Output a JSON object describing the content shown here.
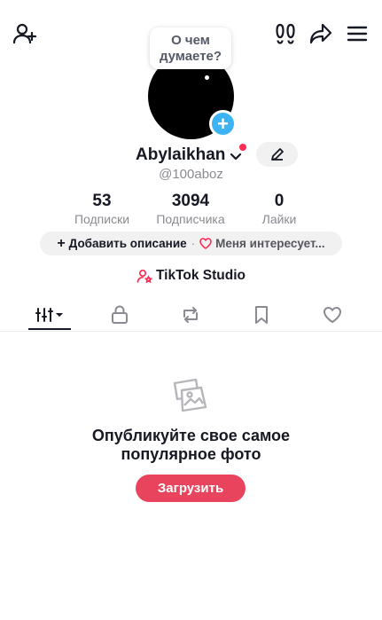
{
  "header": {
    "icons": [
      "add-user-icon",
      "footprints-icon",
      "share-icon",
      "menu-icon"
    ]
  },
  "profile": {
    "bubble_text": "О чем думаете?",
    "username": "Abylaikhan",
    "handle": "@100aboz",
    "avatar_add_label": "+"
  },
  "stats": [
    {
      "value": "53",
      "label": "Подписки"
    },
    {
      "value": "3094",
      "label": "Подписчика"
    },
    {
      "value": "0",
      "label": "Лайки"
    }
  ],
  "bio_pill": {
    "add_description": "Добавить описание",
    "separator": "·",
    "interests": "Меня интересует..."
  },
  "studio": {
    "label": "TikTok Studio"
  },
  "tabs": [
    "posts-grid-icon",
    "lock-icon",
    "repost-icon",
    "bookmark-icon",
    "heart-icon"
  ],
  "empty_state": {
    "title_line1": "Опубликуйте свое самое",
    "title_line2": "популярное фото",
    "button_label": "Загрузить"
  },
  "colors": {
    "accent": "#fe2c55",
    "upload_button": "#e8445d",
    "avatar_plus": "#3cb3f2",
    "muted_text": "#8a8b91"
  }
}
